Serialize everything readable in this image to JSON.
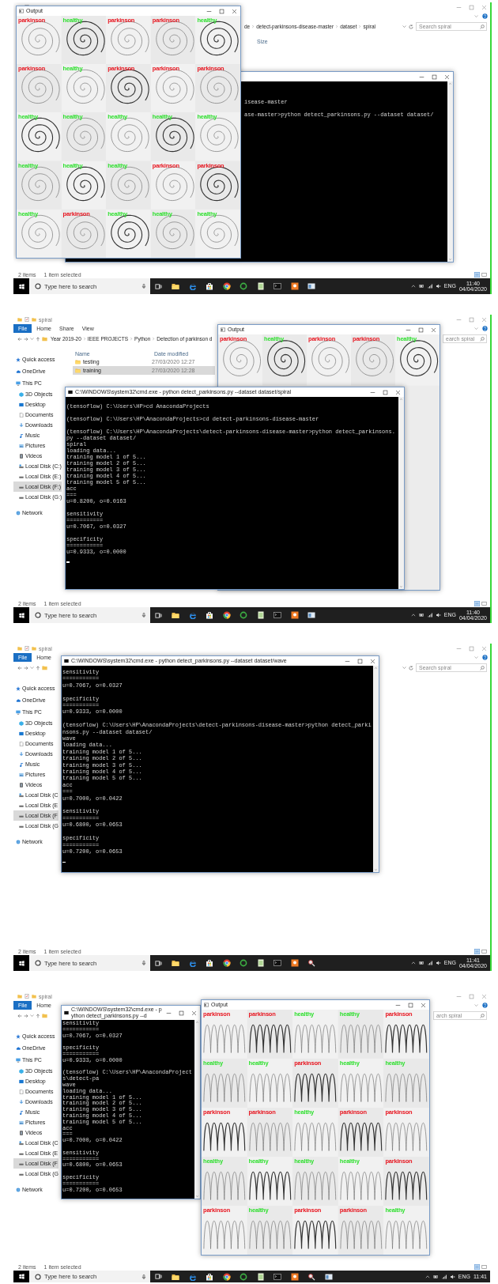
{
  "frames": [
    {
      "explorer": {
        "breadcrumbs": [
          "de",
          "detect-parkinsons-disease-master",
          "dataset",
          "spiral"
        ],
        "search_placeholder": "Search spiral",
        "columns": [
          {
            "label": "Size",
            "kind": "size"
          }
        ],
        "status": [
          "2 items",
          "1 item selected"
        ]
      },
      "windows": [
        {
          "kind": "spiral-output",
          "title": "Output",
          "tiles": [
            {
              "label": "parkinson",
              "color": "#e8141e"
            },
            {
              "label": "healthy",
              "color": "#2fe02f"
            },
            {
              "label": "parkinson",
              "color": "#e8141e"
            },
            {
              "label": "parkinson",
              "color": "#e8141e"
            },
            {
              "label": "healthy",
              "color": "#2fe02f"
            },
            {
              "label": "parkinson",
              "color": "#e8141e"
            },
            {
              "label": "healthy",
              "color": "#2fe02f"
            },
            {
              "label": "parkinson",
              "color": "#e8141e"
            },
            {
              "label": "parkinson",
              "color": "#e8141e"
            },
            {
              "label": "parkinson",
              "color": "#e8141e"
            },
            {
              "label": "healthy",
              "color": "#2fe02f"
            },
            {
              "label": "healthy",
              "color": "#2fe02f"
            },
            {
              "label": "healthy",
              "color": "#2fe02f"
            },
            {
              "label": "healthy",
              "color": "#2fe02f"
            },
            {
              "label": "healthy",
              "color": "#2fe02f"
            },
            {
              "label": "healthy",
              "color": "#2fe02f"
            },
            {
              "label": "healthy",
              "color": "#2fe02f"
            },
            {
              "label": "healthy",
              "color": "#2fe02f"
            },
            {
              "label": "parkinson",
              "color": "#e8141e"
            },
            {
              "label": "parkinson",
              "color": "#e8141e"
            },
            {
              "label": "healthy",
              "color": "#2fe02f"
            },
            {
              "label": "parkinson",
              "color": "#e8141e"
            },
            {
              "label": "healthy",
              "color": "#2fe02f"
            },
            {
              "label": "healthy",
              "color": "#2fe02f"
            },
            {
              "label": "healthy",
              "color": "#2fe02f"
            }
          ]
        },
        {
          "kind": "console",
          "cursor": false,
          "blocks": [
            [
              "isease-master"
            ],
            [
              "ase-master>python detect_parkinsons.py --dataset dataset/"
            ]
          ]
        }
      ],
      "taskbar": {
        "search_placeholder": "Type here to search",
        "language": "ENG",
        "time": "11:40",
        "date": "04/04/2020"
      }
    },
    {
      "explorer": {
        "title": "spiral",
        "ribbon_tabs": [
          {
            "label": "File",
            "kind": "file"
          },
          {
            "label": "Home",
            "kind": "tab"
          },
          {
            "label": "Share",
            "kind": "tab"
          },
          {
            "label": "View",
            "kind": "tab"
          }
        ],
        "breadcrumbs": [
          "Year 2019-20",
          "IEEE PROJECTS",
          "Python",
          "Detection of parkinson d"
        ],
        "search_placeholder": "earch spiral",
        "columns": [
          {
            "label": "Name",
            "kind": "name"
          },
          {
            "label": "Date modified",
            "kind": "date"
          }
        ],
        "files": [
          {
            "name": "testing",
            "modified": "27/03/2020 12:27",
            "selected": false
          },
          {
            "name": "training",
            "modified": "27/03/2020 12:28",
            "selected": true
          }
        ],
        "sidebar": [
          {
            "label": "Quick access",
            "kind": "star",
            "selected": false
          },
          {
            "label": "OneDrive",
            "kind": "cloud",
            "selected": false
          },
          {
            "label": "This PC",
            "kind": "computer",
            "selected": false,
            "children": [
              {
                "label": "3D Objects",
                "kind": "cube",
                "selected": false
              },
              {
                "label": "Desktop",
                "kind": "desktop",
                "selected": false
              },
              {
                "label": "Documents",
                "kind": "document",
                "selected": false
              },
              {
                "label": "Downloads",
                "kind": "download",
                "selected": false
              },
              {
                "label": "Music",
                "kind": "music",
                "selected": false
              },
              {
                "label": "Pictures",
                "kind": "picture",
                "selected": false
              },
              {
                "label": "Videos",
                "kind": "video",
                "selected": false
              },
              {
                "label": "Local Disk (C:)",
                "kind": "system-drive",
                "selected": false
              },
              {
                "label": "Local Disk (E:)",
                "kind": "drive",
                "selected": false
              },
              {
                "label": "Local Disk (F:)",
                "kind": "drive",
                "selected": true
              },
              {
                "label": "Local Disk (G:)",
                "kind": "drive",
                "selected": false
              }
            ]
          },
          {
            "label": "Network",
            "kind": "network",
            "selected": false
          }
        ],
        "status": [
          "2 items",
          "1 item selected"
        ]
      },
      "windows": [
        {
          "kind": "spiral-output",
          "title": "Output",
          "tiles": [
            {
              "label": "parkinson",
              "color": "#e8141e"
            },
            {
              "label": "healthy",
              "color": "#2fe02f"
            },
            {
              "label": "parkinson",
              "color": "#e8141e"
            },
            {
              "label": "parkinson",
              "color": "#e8141e"
            },
            {
              "label": "healthy",
              "color": "#2fe02f"
            }
          ]
        },
        {
          "kind": "console",
          "title": "C:\\WINDOWS\\system32\\cmd.exe - python detect_parkinsons.py --dataset dataset/spiral",
          "cursor": true,
          "blocks": [
            [
              "(tensoflow) C:\\Users\\HP>cd AnacondaProjects"
            ],
            [
              "(tensoflow) C:\\Users\\HP\\AnacondaProjects>cd detect-parkinsons-disease-master"
            ],
            [
              "(tensoflow) C:\\Users\\HP\\AnacondaProjects\\detect-parkinsons-disease-master>python detect_parkinsons.py --dataset dataset/",
              "spiral",
              "loading data...",
              "training model 1 of 5...",
              "training model 2 of 5...",
              "training model 3 of 5...",
              "training model 4 of 5...",
              "training model 5 of 5...",
              "acc",
              "===",
              "u=0.8200, o=0.0163"
            ],
            [
              "sensitivity",
              "===========",
              "u=0.7067, o=0.0327"
            ],
            [
              "specificity",
              "===========",
              "u=0.9333, o=0.0000"
            ]
          ]
        }
      ],
      "taskbar": {
        "search_placeholder": "Type here to search",
        "language": "ENG",
        "time": "11:40",
        "date": "04/04/2020"
      }
    },
    {
      "explorer": {
        "title": "spiral",
        "ribbon_tabs": [
          {
            "label": "File",
            "kind": "file"
          },
          {
            "label": "Home",
            "kind": "tab"
          }
        ],
        "search_placeholder": "Search spiral",
        "sidebar": [
          {
            "label": "Quick access",
            "kind": "star",
            "selected": false
          },
          {
            "label": "OneDrive",
            "kind": "cloud",
            "selected": false
          },
          {
            "label": "This PC",
            "kind": "computer",
            "selected": false,
            "children": [
              {
                "label": "3D Objects",
                "kind": "cube",
                "selected": false
              },
              {
                "label": "Desktop",
                "kind": "desktop",
                "selected": false
              },
              {
                "label": "Documents",
                "kind": "document",
                "selected": false
              },
              {
                "label": "Downloads",
                "kind": "download",
                "selected": false
              },
              {
                "label": "Music",
                "kind": "music",
                "selected": false
              },
              {
                "label": "Pictures",
                "kind": "picture",
                "selected": false
              },
              {
                "label": "Videos",
                "kind": "video",
                "selected": false
              },
              {
                "label": "Local Disk (C",
                "kind": "system-drive",
                "selected": false
              },
              {
                "label": "Local Disk (E",
                "kind": "drive",
                "selected": false
              },
              {
                "label": "Local Disk (F",
                "kind": "drive",
                "selected": true
              },
              {
                "label": "Local Disk (G",
                "kind": "drive",
                "selected": false
              }
            ]
          },
          {
            "label": "Network",
            "kind": "network",
            "selected": false
          }
        ],
        "status": [
          "2 items",
          "1 item selected"
        ]
      },
      "windows": [
        {
          "kind": "console",
          "title": "C:\\WINDOWS\\system32\\cmd.exe - python detect_parkinsons.py --dataset dataset/wave",
          "cursor": true,
          "blocks": [
            [
              "sensitivity",
              "===========",
              "u=0.7067, o=0.0327"
            ],
            [
              "specificity",
              "===========",
              "u=0.9333, o=0.0000"
            ],
            [
              "(tensoflow) C:\\Users\\HP\\AnacondaProjects\\detect-parkinsons-disease-master>python detect_parkinsons.py --dataset dataset/",
              "wave",
              "loading data...",
              "training model 1 of 5...",
              "training model 2 of 5...",
              "training model 3 of 5...",
              "training model 4 of 5...",
              "training model 5 of 5...",
              "acc",
              "===",
              "u=0.7000, o=0.0422"
            ],
            [
              "sensitivity",
              "===========",
              "u=0.6800, o=0.0653"
            ],
            [
              "specificity",
              "===========",
              "u=0.7200, o=0.0653"
            ]
          ]
        }
      ],
      "taskbar": {
        "search_placeholder": "Type here to search",
        "language": "ENG",
        "time": "11:41",
        "date": "04/04/2020"
      }
    },
    {
      "explorer": {
        "title": "spiral",
        "ribbon_tabs": [
          {
            "label": "File",
            "kind": "file"
          },
          {
            "label": "Home",
            "kind": "tab"
          }
        ],
        "search_placeholder": "arch spiral",
        "sidebar": [
          {
            "label": "Quick access",
            "kind": "star",
            "selected": false
          },
          {
            "label": "OneDrive",
            "kind": "cloud",
            "selected": false
          },
          {
            "label": "This PC",
            "kind": "computer",
            "selected": false,
            "children": [
              {
                "label": "3D Objects",
                "kind": "cube",
                "selected": false
              },
              {
                "label": "Desktop",
                "kind": "desktop",
                "selected": false
              },
              {
                "label": "Documents",
                "kind": "document",
                "selected": false
              },
              {
                "label": "Downloads",
                "kind": "download",
                "selected": false
              },
              {
                "label": "Music",
                "kind": "music",
                "selected": false
              },
              {
                "label": "Pictures",
                "kind": "picture",
                "selected": false
              },
              {
                "label": "Videos",
                "kind": "video",
                "selected": false
              },
              {
                "label": "Local Disk (C",
                "kind": "system-drive",
                "selected": false
              },
              {
                "label": "Local Disk (E",
                "kind": "drive",
                "selected": false
              },
              {
                "label": "Local Disk (F",
                "kind": "drive",
                "selected": true
              },
              {
                "label": "Local Disk (G",
                "kind": "drive",
                "selected": false
              }
            ]
          },
          {
            "label": "Network",
            "kind": "network",
            "selected": false
          }
        ],
        "status": [
          "2 items",
          "1 item selected"
        ]
      },
      "windows": [
        {
          "kind": "console",
          "title": "C:\\WINDOWS\\system32\\cmd.exe - python detect_parkinsons.py --d",
          "cursor": false,
          "blocks": [
            [
              "sensitivity",
              "===========",
              "u=0.7067, o=0.0327"
            ],
            [
              "specificity",
              "===========",
              "u=0.9333, o=0.0000"
            ],
            [
              "(tensoflow) C:\\Users\\HP\\AnacondaProjects\\detect-pa",
              "wave",
              "loading data...",
              "training model 1 of 5...",
              "training model 2 of 5...",
              "training model 3 of 5...",
              "training model 4 of 5...",
              "training model 5 of 5...",
              "acc",
              "===",
              "u=0.7000, o=0.0422"
            ],
            [
              "sensitivity",
              "===========",
              "u=0.6800, o=0.0653"
            ],
            [
              "specificity",
              "===========",
              "u=0.7200, o=0.0653"
            ]
          ]
        },
        {
          "kind": "wave-output",
          "title": "Output",
          "tiles": [
            {
              "label": "parkinson",
              "color": "#e8141e"
            },
            {
              "label": "parkinson",
              "color": "#e8141e"
            },
            {
              "label": "healthy",
              "color": "#2fe02f"
            },
            {
              "label": "healthy",
              "color": "#2fe02f"
            },
            {
              "label": "parkinson",
              "color": "#e8141e"
            },
            {
              "label": "healthy",
              "color": "#2fe02f"
            },
            {
              "label": "healthy",
              "color": "#2fe02f"
            },
            {
              "label": "parkinson",
              "color": "#e8141e"
            },
            {
              "label": "healthy",
              "color": "#2fe02f"
            },
            {
              "label": "healthy",
              "color": "#2fe02f"
            },
            {
              "label": "parkinson",
              "color": "#e8141e"
            },
            {
              "label": "parkinson",
              "color": "#e8141e"
            },
            {
              "label": "healthy",
              "color": "#2fe02f"
            },
            {
              "label": "parkinson",
              "color": "#e8141e"
            },
            {
              "label": "parkinson",
              "color": "#e8141e"
            },
            {
              "label": "healthy",
              "color": "#2fe02f"
            },
            {
              "label": "healthy",
              "color": "#2fe02f"
            },
            {
              "label": "healthy",
              "color": "#2fe02f"
            },
            {
              "label": "healthy",
              "color": "#2fe02f"
            },
            {
              "label": "parkinson",
              "color": "#e8141e"
            },
            {
              "label": "parkinson",
              "color": "#e8141e"
            },
            {
              "label": "healthy",
              "color": "#2fe02f"
            },
            {
              "label": "parkinson",
              "color": "#e8141e"
            },
            {
              "label": "parkinson",
              "color": "#e8141e"
            },
            {
              "label": "healthy",
              "color": "#2fe02f"
            }
          ]
        }
      ],
      "taskbar": {
        "search_placeholder": "Type here to search",
        "language": "ENG",
        "time": "11:41"
      }
    }
  ]
}
